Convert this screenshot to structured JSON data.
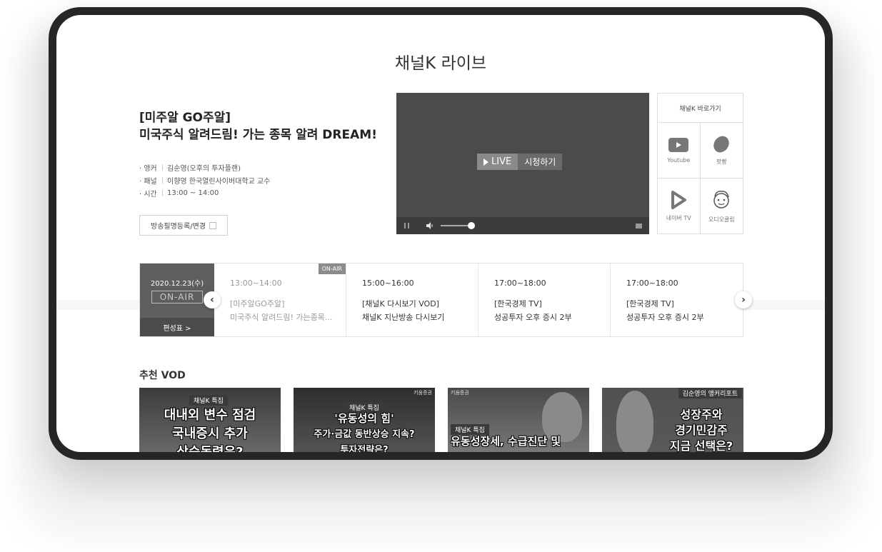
{
  "page": {
    "title": "채널K 라이브"
  },
  "program": {
    "bracket_title": "[미주알 GO주알]",
    "title": "미국주식 알려드림! 가는 종목 알려 DREAM!",
    "info": [
      {
        "label": "· 앵커",
        "value": "김순영(오후의 투자플랜)"
      },
      {
        "label": "· 패널",
        "value": "이향영 한국열린사이버대학교 교수"
      },
      {
        "label": "· 시간",
        "value": "13:00 ~ 14:00"
      }
    ],
    "register_button": "방송필명등록/변경"
  },
  "player": {
    "live_label": "LIVE",
    "watch_label": "시청하기"
  },
  "shortcuts": {
    "title": "채널K 바로가기",
    "items": [
      {
        "label": "Youtube",
        "icon": "youtube-icon"
      },
      {
        "label": "팟빵",
        "icon": "podbbang-icon"
      },
      {
        "label": "네이버 TV",
        "icon": "naver-tv-icon"
      },
      {
        "label": "오디오클립",
        "icon": "audioclip-icon"
      }
    ]
  },
  "schedule": {
    "date": "2020.12.23(수)",
    "onair_badge": "ON-AIR",
    "schedule_link": "편성표 >",
    "slots": [
      {
        "time": "13:00~14:00",
        "channel": "[미주알GO주알]",
        "desc": "미국주식 알려드림! 가는종목...",
        "onair_tag": "ON-AIR"
      },
      {
        "time": "15:00~16:00",
        "channel": "[채널K 다시보기 VOD]",
        "desc": "채널K 지난방송 다시보기"
      },
      {
        "time": "17:00~18:00",
        "channel": "[한국경제 TV]",
        "desc": "성공투자 오후 증시 2부"
      },
      {
        "time": "17:00~18:00",
        "channel": "[한국경제 TV]",
        "desc": "성공투자 오후 증시 2부"
      }
    ]
  },
  "vod": {
    "title": "추천 VOD",
    "cards": [
      {
        "tag": "채널K 특집",
        "line1": "대내외 변수 점검",
        "line2": "국내증시 추가",
        "line3": "상승동력은?"
      },
      {
        "tag": "채널K 특집",
        "corner": "키움증권",
        "line1": "'유동성의 힘'",
        "line2": "주가·금값 동반상승 지속?",
        "line3": "투자전략은?"
      },
      {
        "tag": "채널K 특집",
        "corner": "키움증권",
        "line1": "유동성장세, 수급진단 및"
      },
      {
        "tag": "김순영의 앵커리포트",
        "line1": "성장주와",
        "line2": "경기민감주",
        "line3": "지금 선택은?"
      }
    ]
  }
}
